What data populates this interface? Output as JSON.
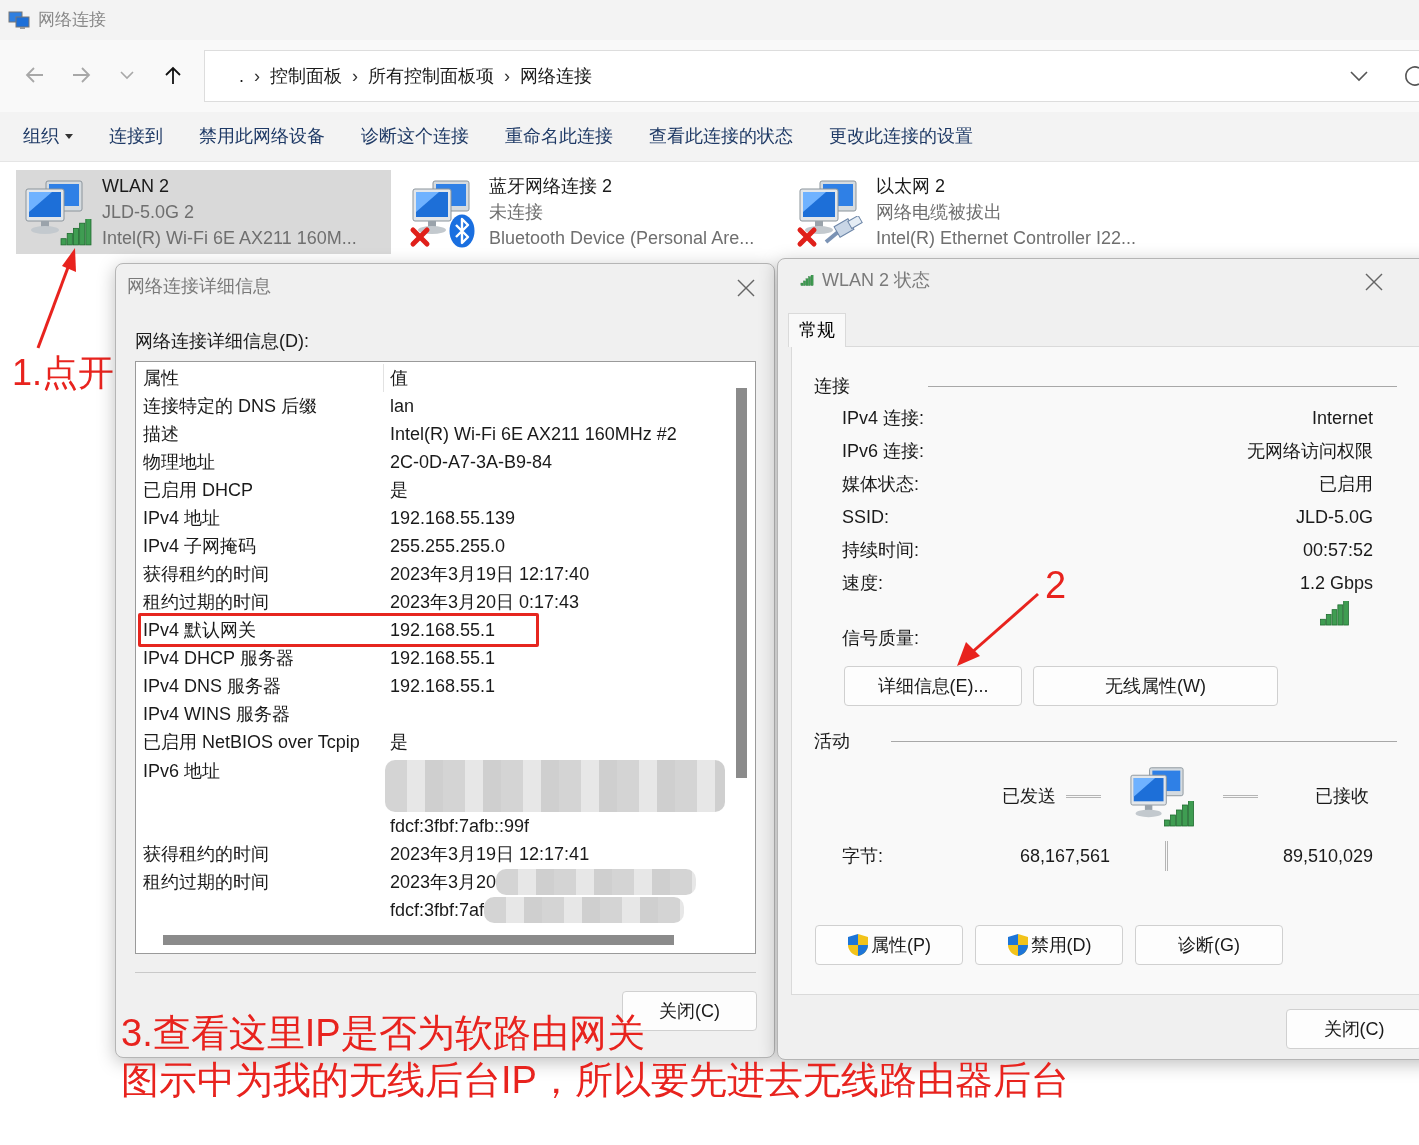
{
  "window": {
    "title": "网络连接"
  },
  "navigation": [
    {
      "kind": "back",
      "disabled": true
    },
    {
      "kind": "forward",
      "disabled": true
    },
    {
      "kind": "recent",
      "disabled": true
    },
    {
      "kind": "up",
      "disabled": false
    }
  ],
  "address_bar": {
    "separator": "›",
    "path": [
      ".",
      "控制面板",
      "所有控制面板项",
      "网络连接"
    ]
  },
  "toolbar": [
    {
      "label": "组织",
      "has_menu": true
    },
    {
      "label": "连接到",
      "has_menu": false
    },
    {
      "label": "禁用此网络设备",
      "has_menu": false
    },
    {
      "label": "诊断这个连接",
      "has_menu": false
    },
    {
      "label": "重命名此连接",
      "has_menu": false
    },
    {
      "label": "查看此连接的状态",
      "has_menu": false
    },
    {
      "label": "更改此连接的设置",
      "has_menu": false
    }
  ],
  "connections": [
    {
      "name": "WLAN 2",
      "status": "JLD-5.0G 2",
      "device": "Intel(R) Wi-Fi 6E AX211 160M...",
      "kind": "wifi",
      "connected": true,
      "selected": true
    },
    {
      "name": "蓝牙网络连接 2",
      "status": "未连接",
      "device": "Bluetooth Device (Personal Are...",
      "kind": "bluetooth",
      "connected": false,
      "selected": false
    },
    {
      "name": "以太网 2",
      "status": "网络电缆被拔出",
      "device": "Intel(R) Ethernet Controller I22...",
      "kind": "ethernet",
      "connected": false,
      "selected": false
    }
  ],
  "details_dialog": {
    "title": "网络连接详细信息",
    "label": "网络连接详细信息(D):",
    "columns": [
      "属性",
      "值"
    ],
    "rows": [
      {
        "property": "连接特定的 DNS 后缀",
        "value": "lan"
      },
      {
        "property": "描述",
        "value": "Intel(R) Wi-Fi 6E AX211 160MHz #2"
      },
      {
        "property": "物理地址",
        "value": "2C-0D-A7-3A-B9-84"
      },
      {
        "property": "已启用 DHCP",
        "value": "是"
      },
      {
        "property": "IPv4 地址",
        "value": "192.168.55.139"
      },
      {
        "property": "IPv4 子网掩码",
        "value": "255.255.255.0"
      },
      {
        "property": "获得租约的时间",
        "value": "2023年3月19日 12:17:40"
      },
      {
        "property": "租约过期的时间",
        "value": "2023年3月20日 0:17:43"
      },
      {
        "property": "IPv4 默认网关",
        "value": "192.168.55.1",
        "highlighted": true
      },
      {
        "property": "IPv4 DHCP 服务器",
        "value": "192.168.55.1"
      },
      {
        "property": "IPv4 DNS 服务器",
        "value": "192.168.55.1"
      },
      {
        "property": "IPv4 WINS 服务器"
      },
      {
        "property": "已启用 NetBIOS over Tcpip",
        "value": "是"
      },
      {
        "property": "IPv6 地址",
        "redacted": true
      },
      {
        "value": "fdcf:3fbf:7afb::99f"
      },
      {
        "property": "获得租约的时间",
        "value": "2023年3月19日 12:17:41"
      },
      {
        "property": "租约过期的时间",
        "value": "2023年3月20",
        "redacted": true
      },
      {
        "value": "fdcf:3fbf:7af",
        "redacted": true
      }
    ],
    "close_button": "关闭(C)"
  },
  "status_dialog": {
    "title": "WLAN 2 状态",
    "tabs": [
      {
        "label": "常规",
        "selected": true
      }
    ],
    "connection": {
      "heading": "连接",
      "rows": [
        {
          "label": "IPv4 连接:",
          "value": "Internet"
        },
        {
          "label": "IPv6 连接:",
          "value": "无网络访问权限"
        },
        {
          "label": "媒体状态:",
          "value": "已启用"
        },
        {
          "label": "SSID:",
          "value": "JLD-5.0G"
        },
        {
          "label": "持续时间:",
          "value": "00:57:52"
        },
        {
          "label": "速度:",
          "value": "1.2 Gbps"
        }
      ],
      "signal_label": "信号质量:"
    },
    "buttons": [
      "详细信息(E)...",
      "无线属性(W)"
    ],
    "activity": {
      "heading": "活动",
      "sent_label": "已发送",
      "received_label": "已接收",
      "bytes_label": "字节:",
      "sent": "68,167,561",
      "received": "89,510,029"
    },
    "action_buttons": [
      {
        "label": "属性(P)",
        "shield": true
      },
      {
        "label": "禁用(D)",
        "shield": true
      },
      {
        "label": "诊断(G)",
        "shield": false
      }
    ],
    "close_button": "关闭(C)"
  },
  "annotations": [
    {
      "text": "1.点开"
    },
    {
      "text": "2"
    },
    {
      "text": "3.查看这里IP是否为软路由网关"
    },
    {
      "text": "图示中为我的无线后台IP，所以要先进去无线路由器后台"
    }
  ]
}
